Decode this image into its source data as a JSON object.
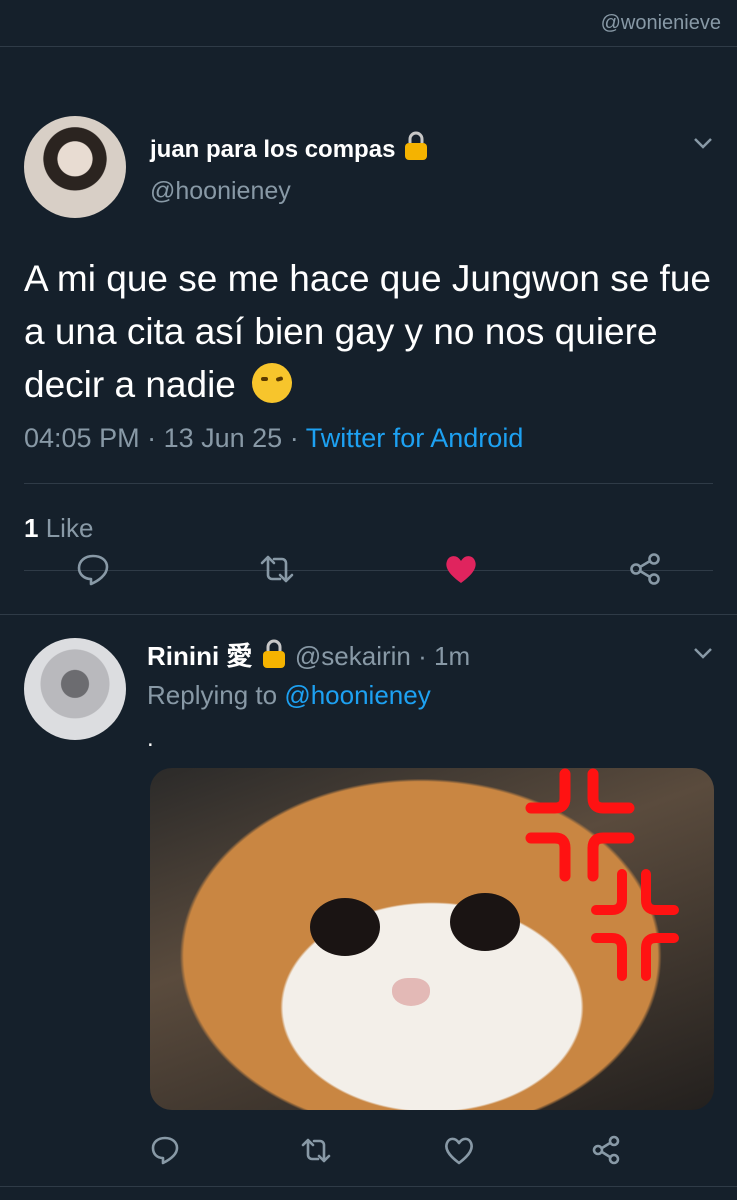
{
  "watermark": "@wonienieve",
  "main_tweet": {
    "display_name": "juan para los compas",
    "handle": "@hoonieney",
    "text": "A mi que se me hace que Jungwon se fue a una cita así bien gay y no nos quiere decir a nadie",
    "emoji_icon": "raised-eyebrow-emoji-icon",
    "time": "04:05 PM",
    "date": "13 Jun 25",
    "source": "Twitter for Android",
    "like_count": "1",
    "like_label": "Like",
    "liked": true
  },
  "reply_tweet": {
    "display_name": "Rinini 愛",
    "handle": "@sekairin",
    "age": "1m",
    "replying_prefix": "Replying to",
    "replying_handle": "@hoonieney",
    "text": ".",
    "media_icon": "angry-cat-image"
  },
  "colors": {
    "background": "#15202b",
    "accent": "#1da1f2",
    "like": "#e0245e",
    "secondary": "#8899a6",
    "divider": "#2f3b47"
  }
}
